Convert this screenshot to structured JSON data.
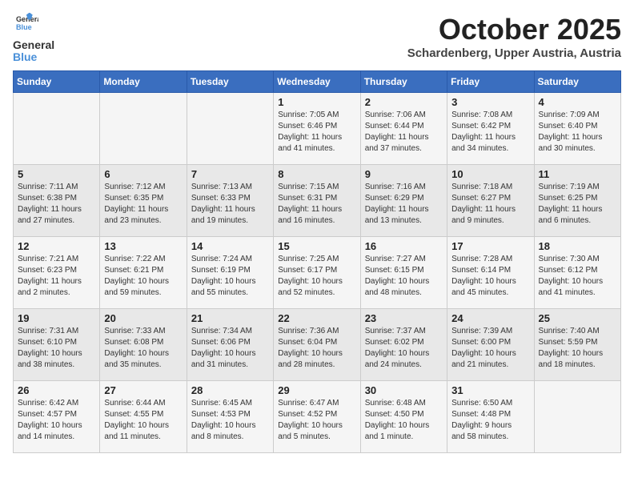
{
  "logo": {
    "line1": "General",
    "line2": "Blue"
  },
  "title": "October 2025",
  "location": "Schardenberg, Upper Austria, Austria",
  "days_of_week": [
    "Sunday",
    "Monday",
    "Tuesday",
    "Wednesday",
    "Thursday",
    "Friday",
    "Saturday"
  ],
  "weeks": [
    [
      {
        "day": "",
        "text": ""
      },
      {
        "day": "",
        "text": ""
      },
      {
        "day": "",
        "text": ""
      },
      {
        "day": "1",
        "text": "Sunrise: 7:05 AM\nSunset: 6:46 PM\nDaylight: 11 hours\nand 41 minutes."
      },
      {
        "day": "2",
        "text": "Sunrise: 7:06 AM\nSunset: 6:44 PM\nDaylight: 11 hours\nand 37 minutes."
      },
      {
        "day": "3",
        "text": "Sunrise: 7:08 AM\nSunset: 6:42 PM\nDaylight: 11 hours\nand 34 minutes."
      },
      {
        "day": "4",
        "text": "Sunrise: 7:09 AM\nSunset: 6:40 PM\nDaylight: 11 hours\nand 30 minutes."
      }
    ],
    [
      {
        "day": "5",
        "text": "Sunrise: 7:11 AM\nSunset: 6:38 PM\nDaylight: 11 hours\nand 27 minutes."
      },
      {
        "day": "6",
        "text": "Sunrise: 7:12 AM\nSunset: 6:35 PM\nDaylight: 11 hours\nand 23 minutes."
      },
      {
        "day": "7",
        "text": "Sunrise: 7:13 AM\nSunset: 6:33 PM\nDaylight: 11 hours\nand 19 minutes."
      },
      {
        "day": "8",
        "text": "Sunrise: 7:15 AM\nSunset: 6:31 PM\nDaylight: 11 hours\nand 16 minutes."
      },
      {
        "day": "9",
        "text": "Sunrise: 7:16 AM\nSunset: 6:29 PM\nDaylight: 11 hours\nand 13 minutes."
      },
      {
        "day": "10",
        "text": "Sunrise: 7:18 AM\nSunset: 6:27 PM\nDaylight: 11 hours\nand 9 minutes."
      },
      {
        "day": "11",
        "text": "Sunrise: 7:19 AM\nSunset: 6:25 PM\nDaylight: 11 hours\nand 6 minutes."
      }
    ],
    [
      {
        "day": "12",
        "text": "Sunrise: 7:21 AM\nSunset: 6:23 PM\nDaylight: 11 hours\nand 2 minutes."
      },
      {
        "day": "13",
        "text": "Sunrise: 7:22 AM\nSunset: 6:21 PM\nDaylight: 10 hours\nand 59 minutes."
      },
      {
        "day": "14",
        "text": "Sunrise: 7:24 AM\nSunset: 6:19 PM\nDaylight: 10 hours\nand 55 minutes."
      },
      {
        "day": "15",
        "text": "Sunrise: 7:25 AM\nSunset: 6:17 PM\nDaylight: 10 hours\nand 52 minutes."
      },
      {
        "day": "16",
        "text": "Sunrise: 7:27 AM\nSunset: 6:15 PM\nDaylight: 10 hours\nand 48 minutes."
      },
      {
        "day": "17",
        "text": "Sunrise: 7:28 AM\nSunset: 6:14 PM\nDaylight: 10 hours\nand 45 minutes."
      },
      {
        "day": "18",
        "text": "Sunrise: 7:30 AM\nSunset: 6:12 PM\nDaylight: 10 hours\nand 41 minutes."
      }
    ],
    [
      {
        "day": "19",
        "text": "Sunrise: 7:31 AM\nSunset: 6:10 PM\nDaylight: 10 hours\nand 38 minutes."
      },
      {
        "day": "20",
        "text": "Sunrise: 7:33 AM\nSunset: 6:08 PM\nDaylight: 10 hours\nand 35 minutes."
      },
      {
        "day": "21",
        "text": "Sunrise: 7:34 AM\nSunset: 6:06 PM\nDaylight: 10 hours\nand 31 minutes."
      },
      {
        "day": "22",
        "text": "Sunrise: 7:36 AM\nSunset: 6:04 PM\nDaylight: 10 hours\nand 28 minutes."
      },
      {
        "day": "23",
        "text": "Sunrise: 7:37 AM\nSunset: 6:02 PM\nDaylight: 10 hours\nand 24 minutes."
      },
      {
        "day": "24",
        "text": "Sunrise: 7:39 AM\nSunset: 6:00 PM\nDaylight: 10 hours\nand 21 minutes."
      },
      {
        "day": "25",
        "text": "Sunrise: 7:40 AM\nSunset: 5:59 PM\nDaylight: 10 hours\nand 18 minutes."
      }
    ],
    [
      {
        "day": "26",
        "text": "Sunrise: 6:42 AM\nSunset: 4:57 PM\nDaylight: 10 hours\nand 14 minutes."
      },
      {
        "day": "27",
        "text": "Sunrise: 6:44 AM\nSunset: 4:55 PM\nDaylight: 10 hours\nand 11 minutes."
      },
      {
        "day": "28",
        "text": "Sunrise: 6:45 AM\nSunset: 4:53 PM\nDaylight: 10 hours\nand 8 minutes."
      },
      {
        "day": "29",
        "text": "Sunrise: 6:47 AM\nSunset: 4:52 PM\nDaylight: 10 hours\nand 5 minutes."
      },
      {
        "day": "30",
        "text": "Sunrise: 6:48 AM\nSunset: 4:50 PM\nDaylight: 10 hours\nand 1 minute."
      },
      {
        "day": "31",
        "text": "Sunrise: 6:50 AM\nSunset: 4:48 PM\nDaylight: 9 hours\nand 58 minutes."
      },
      {
        "day": "",
        "text": ""
      }
    ]
  ]
}
